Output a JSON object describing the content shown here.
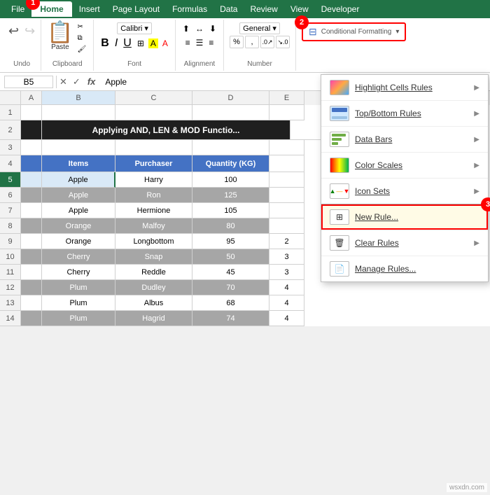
{
  "menu": {
    "items": [
      "File",
      "Home",
      "Insert",
      "Page Layout",
      "Formulas",
      "Data",
      "Review",
      "View",
      "Developer"
    ]
  },
  "ribbon": {
    "undo_icon": "↩",
    "redo_icon": "↪",
    "groups": [
      {
        "label": "Undo"
      },
      {
        "label": "Clipboard"
      },
      {
        "label": "Font"
      },
      {
        "label": "Alignment"
      },
      {
        "label": "Number"
      }
    ],
    "cf_button_label": "Conditional Formatting",
    "cf_dropdown_arrow": "▾"
  },
  "formula_bar": {
    "cell_ref": "B5",
    "value": "Apple"
  },
  "dropdown": {
    "items": [
      {
        "label": "Highlight Cells Rules",
        "has_arrow": true
      },
      {
        "label": "Top/Bottom Rules",
        "has_arrow": true
      },
      {
        "label": "Data Bars",
        "has_arrow": true
      },
      {
        "label": "Color Scales",
        "has_arrow": true
      },
      {
        "label": "Icon Sets",
        "has_arrow": true
      },
      {
        "label": "New Rule...",
        "has_arrow": false,
        "highlighted": true
      },
      {
        "label": "Clear Rules",
        "has_arrow": true
      },
      {
        "label": "Manage Rules...",
        "has_arrow": false
      }
    ]
  },
  "steps": {
    "s1": "1",
    "s2": "2",
    "s3": "3"
  },
  "spreadsheet": {
    "col_headers": [
      "",
      "A",
      "B",
      "C",
      "D",
      "E"
    ],
    "title_row": "Applying AND, LEN & MOD Functio...",
    "table_headers": [
      "Items",
      "Purchaser",
      "Quantity (KG)"
    ],
    "rows": [
      {
        "num": 1,
        "A": "",
        "B": "",
        "C": "",
        "D": "",
        "E": ""
      },
      {
        "num": 2,
        "A": "",
        "B": "Applying AND, LEN & MOD Functio...",
        "C": "",
        "D": "",
        "E": ""
      },
      {
        "num": 3,
        "A": "",
        "B": "",
        "C": "",
        "D": "",
        "E": ""
      },
      {
        "num": 4,
        "A": "",
        "B": "Items",
        "C": "Purchaser",
        "D": "Quantity (KG)",
        "E": ""
      },
      {
        "num": 5,
        "A": "",
        "B": "Apple",
        "C": "Harry",
        "D": "100",
        "E": ""
      },
      {
        "num": 6,
        "A": "",
        "B": "Apple",
        "C": "Ron",
        "D": "125",
        "E": ""
      },
      {
        "num": 7,
        "A": "",
        "B": "Apple",
        "C": "Hermione",
        "D": "105",
        "E": ""
      },
      {
        "num": 8,
        "A": "",
        "B": "Orange",
        "C": "Malfoy",
        "D": "80",
        "E": ""
      },
      {
        "num": 9,
        "A": "",
        "B": "Orange",
        "C": "Longbottom",
        "D": "95",
        "E": "2"
      },
      {
        "num": 10,
        "A": "",
        "B": "Cherry",
        "C": "Snap",
        "D": "50",
        "E": "3"
      },
      {
        "num": 11,
        "A": "",
        "B": "Cherry",
        "C": "Reddle",
        "D": "45",
        "E": "3"
      },
      {
        "num": 12,
        "A": "",
        "B": "Plum",
        "C": "Dudley",
        "D": "70",
        "E": "4"
      },
      {
        "num": 13,
        "A": "",
        "B": "Plum",
        "C": "Albus",
        "D": "68",
        "E": "4"
      },
      {
        "num": 14,
        "A": "",
        "B": "Plum",
        "C": "Hagrid",
        "D": "74",
        "E": "4"
      }
    ]
  },
  "watermark": "wsxdn.com"
}
